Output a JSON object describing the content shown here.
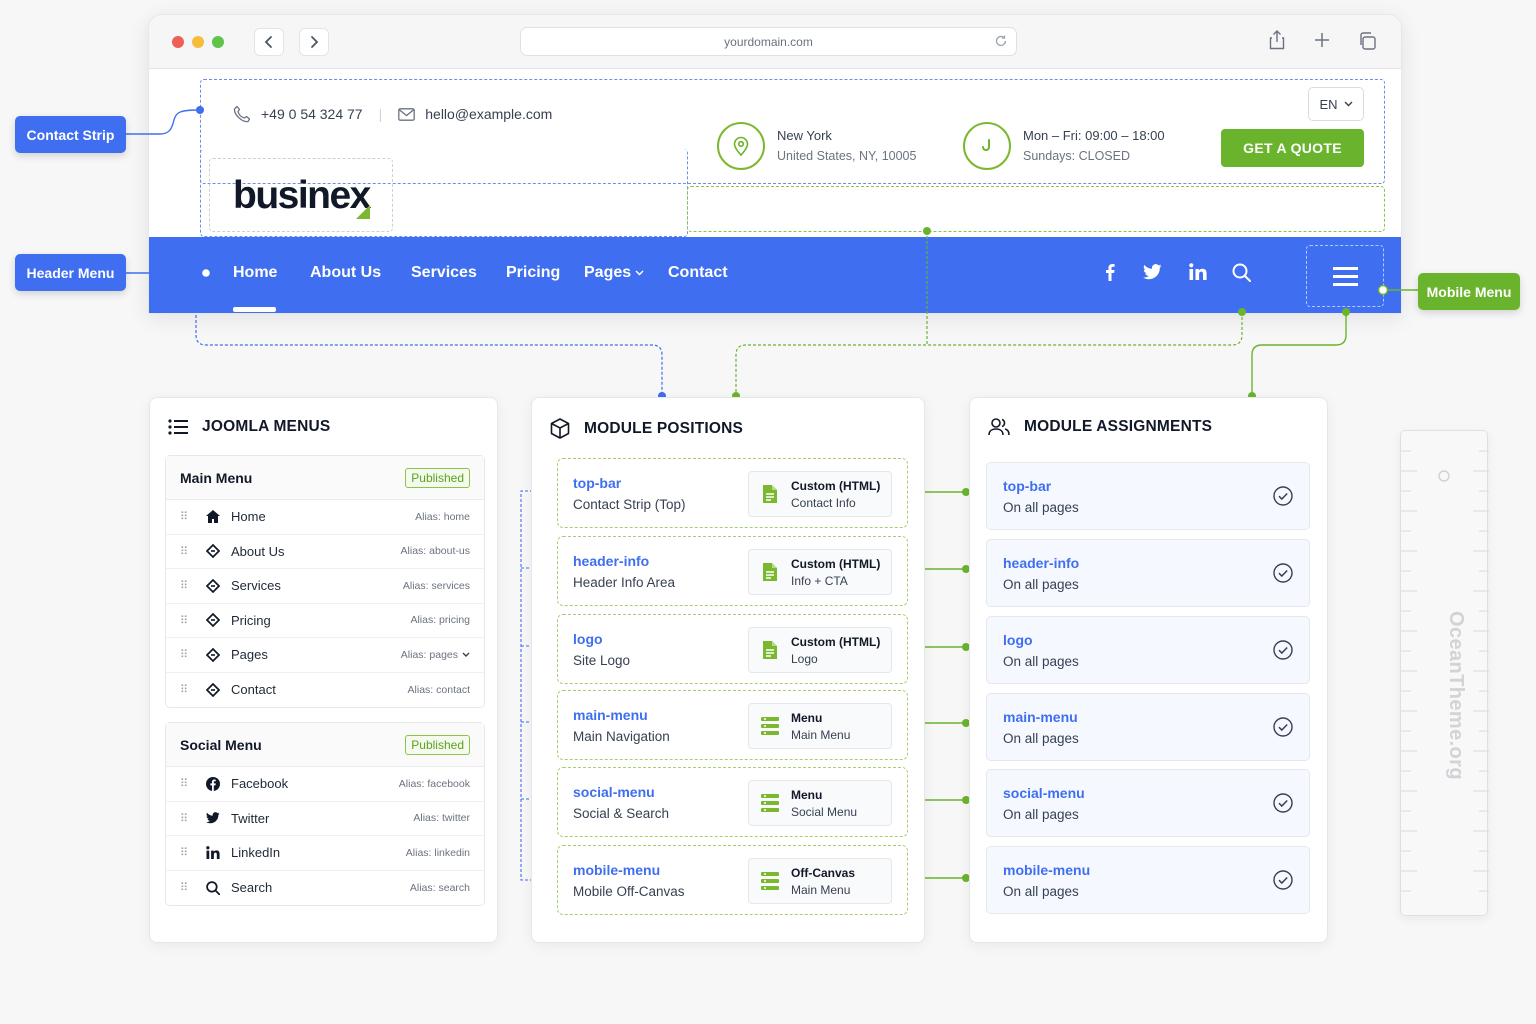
{
  "browser": {
    "url": "yourdomain.com"
  },
  "site": {
    "phone": "+49 0 54 324 77",
    "email": "hello@example.com",
    "logo_text": "businex",
    "location_line1": "New York",
    "location_line2": "United States, NY, 10005",
    "hours_line1": "Mon – Fri: 09:00 – 18:00",
    "hours_line2": "Sundays: CLOSED",
    "language": "EN",
    "quote_button": "GET A QUOTE",
    "nav": [
      {
        "label": "Home"
      },
      {
        "label": "About Us"
      },
      {
        "label": "Services"
      },
      {
        "label": "Pricing"
      },
      {
        "label": "Pages"
      },
      {
        "label": "Contact"
      }
    ]
  },
  "labels": {
    "contact_strip": "Contact Strip",
    "header_menu": "Header Menu",
    "mobile_menu": "Mobile Menu"
  },
  "colors": {
    "brand_blue": "#3f6ff0",
    "brand_green": "#6ab42d"
  },
  "joomla": {
    "title": "JOOMLA MENUS",
    "main_menu": {
      "title": "Main Menu",
      "status": "Published",
      "items": [
        {
          "label": "Home",
          "alias": "Alias: home",
          "icon": "home-icon"
        },
        {
          "label": "About Us",
          "alias": "Alias: about-us",
          "icon": "diamond-arrow-icon"
        },
        {
          "label": "Services",
          "alias": "Alias: services",
          "icon": "diamond-arrow-icon"
        },
        {
          "label": "Pricing",
          "alias": "Alias: pricing",
          "icon": "diamond-arrow-icon"
        },
        {
          "label": "Pages",
          "alias": "Alias: pages",
          "icon": "diamond-arrow-icon"
        },
        {
          "label": "Contact",
          "alias": "Alias: contact",
          "icon": "diamond-arrow-icon"
        }
      ]
    },
    "social_menu": {
      "title": "Social Menu",
      "status": "Published",
      "items": [
        {
          "label": "Facebook",
          "alias": "Alias: facebook",
          "icon": "facebook-icon"
        },
        {
          "label": "Twitter",
          "alias": "Alias: twitter",
          "icon": "twitter-icon"
        },
        {
          "label": "LinkedIn",
          "alias": "Alias: linkedin",
          "icon": "linkedin-icon"
        },
        {
          "label": "Search",
          "alias": "Alias: search",
          "icon": "search-icon"
        }
      ]
    }
  },
  "positions": {
    "title": "MODULE POSITIONS",
    "items": [
      {
        "name": "top-bar",
        "desc": "Contact Strip (Top)",
        "module_type": "Custom (HTML)",
        "module_name": "Contact Info",
        "icon": "document-icon"
      },
      {
        "name": "header-info",
        "desc": "Header Info Area",
        "module_type": "Custom (HTML)",
        "module_name": "Info + CTA",
        "icon": "document-icon"
      },
      {
        "name": "logo",
        "desc": "Site Logo",
        "module_type": "Custom (HTML)",
        "module_name": "Logo",
        "icon": "document-icon"
      },
      {
        "name": "main-menu",
        "desc": "Main Navigation",
        "module_type": "Menu",
        "module_name": "Main Menu",
        "icon": "menu-list-icon"
      },
      {
        "name": "social-menu",
        "desc": "Social & Search",
        "module_type": "Menu",
        "module_name": "Social Menu",
        "icon": "menu-list-icon"
      },
      {
        "name": "mobile-menu",
        "desc": "Mobile Off-Canvas",
        "module_type": "Off-Canvas",
        "module_name": "Main Menu",
        "icon": "menu-list-icon"
      }
    ]
  },
  "assignments": {
    "title": "MODULE ASSIGNMENTS",
    "items": [
      {
        "name": "top-bar",
        "scope": "On all pages"
      },
      {
        "name": "header-info",
        "scope": "On all pages"
      },
      {
        "name": "logo",
        "scope": "On all pages"
      },
      {
        "name": "main-menu",
        "scope": "On all pages"
      },
      {
        "name": "social-menu",
        "scope": "On all pages"
      },
      {
        "name": "mobile-menu",
        "scope": "On all pages"
      }
    ]
  },
  "watermark": "OceanTheme.org"
}
